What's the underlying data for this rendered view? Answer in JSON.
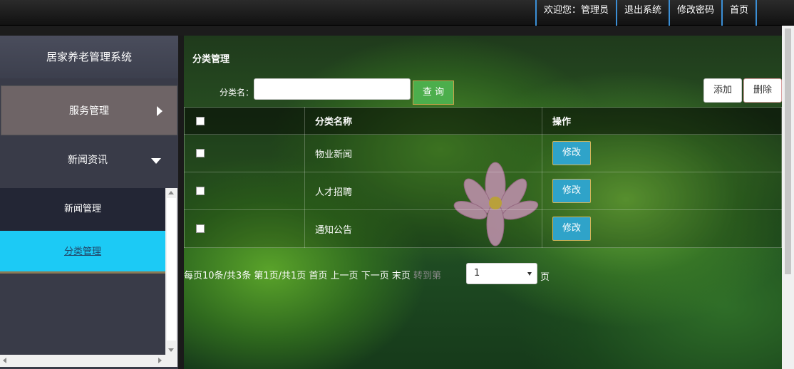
{
  "topnav": {
    "welcome": "欢迎您：管理员",
    "logout": "退出系统",
    "change_password": "修改密码",
    "home": "首页"
  },
  "sidebar": {
    "title": "居家养老管理系统",
    "groups": [
      {
        "label": "服务管理"
      },
      {
        "label": "新闻资讯"
      }
    ],
    "subitems": [
      {
        "label": "新闻管理"
      },
      {
        "label": "分类管理"
      }
    ]
  },
  "main": {
    "panel_title": "分类管理",
    "search_label": "分类名：",
    "search_value": "",
    "query_label": "查 询",
    "add_label": "添加",
    "delete_label": "删除",
    "table": {
      "headers": [
        "分类名称",
        "操作"
      ],
      "rows": [
        {
          "name": "物业新闻",
          "action": "修改"
        },
        {
          "name": "人才招聘",
          "action": "修改"
        },
        {
          "name": "通知公告",
          "action": "修改"
        }
      ]
    },
    "pager": {
      "info": "每页10条/共3条 第1页/共1页",
      "first": "首页",
      "prev": "上一页",
      "next": "下一页",
      "last": "末页",
      "jump": "转到第",
      "page_value": "1",
      "unit": "页"
    }
  }
}
